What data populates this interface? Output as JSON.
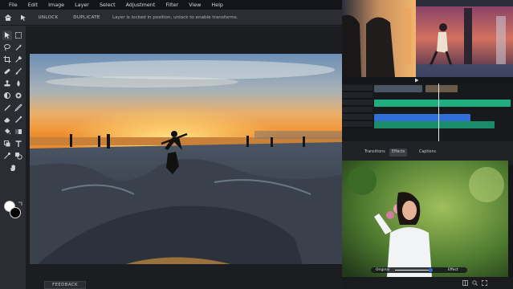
{
  "menu": [
    "File",
    "Edit",
    "Image",
    "Layer",
    "Select",
    "Adjustment",
    "Filter",
    "View",
    "Help"
  ],
  "toolbar": {
    "unlock_label": "UNLOCK",
    "duplicate_label": "DUPLICATE",
    "message": "Layer is locked in position, unlock to enable transforms."
  },
  "feedback_label": "FEEDBACK",
  "video_tabs": [
    "Transitions",
    "Effects",
    "Captions"
  ],
  "portrait": {
    "original_label": "Original",
    "effect_label": "Effect",
    "effect_fraction": 0.72
  },
  "colors": {
    "accent_green": "#1fae7d",
    "accent_blue": "#2f6fd6",
    "sky_orange": "#f1a24a"
  },
  "icons": [
    "home-icon",
    "move-icon",
    "marquee-icon",
    "lasso-icon",
    "magic-wand-icon",
    "crop-icon",
    "eyedropper-icon",
    "heal-icon",
    "brush-icon",
    "stamp-icon",
    "blur-icon",
    "dodge-icon",
    "pen-icon",
    "gradient-icon",
    "type-icon",
    "shape-icon",
    "hand-icon"
  ]
}
